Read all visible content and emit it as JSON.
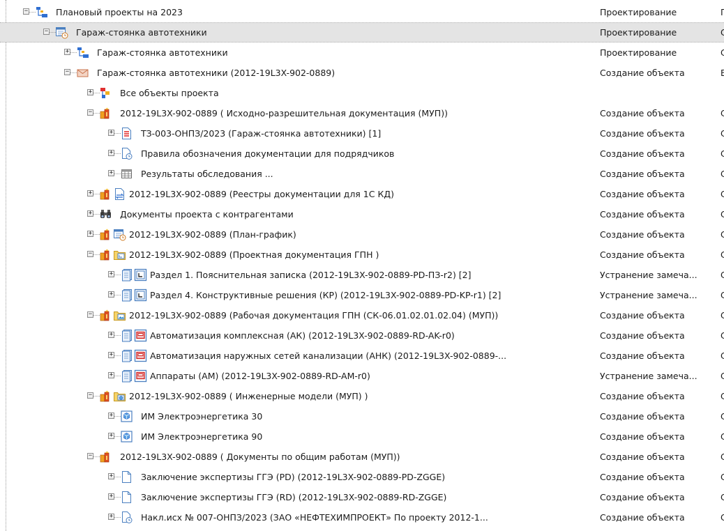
{
  "tree": {
    "rows": [
      {
        "depth": 0,
        "toggle": "minus",
        "icons": [
          "project-plan-icon"
        ],
        "label": "Плановый проекты на 2023",
        "status": "Проектирование",
        "extra": "П"
      },
      {
        "depth": 1,
        "toggle": "minus",
        "icons": [
          "calendar-clock-icon"
        ],
        "label": "Гараж-стоянка автотехники",
        "status": "Проектирование",
        "extra": "С",
        "selected": true
      },
      {
        "depth": 2,
        "toggle": "plus",
        "icons": [
          "project-plan-icon"
        ],
        "label": "Гараж-стоянка автотехники",
        "status": "Проектирование",
        "extra": "С"
      },
      {
        "depth": 2,
        "toggle": "minus",
        "icons": [
          "envelope-icon"
        ],
        "label": "Гараж-стоянка автотехники (2012-19L3X-902-0889)",
        "status": "Создание объекта",
        "extra": "В"
      },
      {
        "depth": 3,
        "toggle": "plus",
        "icons": [
          "object-structure-icon"
        ],
        "label": "Все объекты проекта",
        "status": "",
        "extra": ""
      },
      {
        "depth": 3,
        "toggle": "minus",
        "icons": [
          "package-icon"
        ],
        "label": "2012-19L3X-902-0889 (  Исходно-разрешительная документация (МУП))",
        "status": "Создание объекта",
        "extra": "С"
      },
      {
        "depth": 4,
        "toggle": "plus",
        "icons": [
          "red-document-icon"
        ],
        "label": "ТЗ-003-ОНПЗ/2023 (Гараж-стоянка автотехники) [1]",
        "status": "Создание объекта",
        "extra": "С"
      },
      {
        "depth": 4,
        "toggle": "plus",
        "icons": [
          "document-clock-icon"
        ],
        "label": "Правила обозначения документации для подрядчиков",
        "status": "Создание объекта",
        "extra": "С"
      },
      {
        "depth": 4,
        "toggle": "plus",
        "icons": [
          "table-icon"
        ],
        "label": "Результаты обследования ...",
        "status": "Создание объекта",
        "extra": "С"
      },
      {
        "depth": 3,
        "toggle": "plus",
        "icons": [
          "package-icon",
          "registry-sync-icon"
        ],
        "label": "2012-19L3X-902-0889 (Реестры документации для 1С КД)",
        "status": "Создание объекта",
        "extra": "С"
      },
      {
        "depth": 3,
        "toggle": "plus",
        "icons": [
          "binoculars-icon"
        ],
        "label": "Документы проекта с контрагентами",
        "status": "Создание объекта",
        "extra": "С"
      },
      {
        "depth": 3,
        "toggle": "plus",
        "icons": [
          "package-icon",
          "calendar-clock-icon"
        ],
        "label": "2012-19L3X-902-0889 (План-график)",
        "status": "Создание объекта",
        "extra": "С"
      },
      {
        "depth": 3,
        "toggle": "minus",
        "icons": [
          "package-icon",
          "folder-drawing-icon"
        ],
        "label": "2012-19L3X-902-0889 (Проектная документация ГПН  )",
        "status": "Создание объекта",
        "extra": "С"
      },
      {
        "depth": 4,
        "toggle": "plus",
        "icons": [
          "document-stack-icon",
          "drawing-sheet-icon"
        ],
        "label": "Раздел 1. Пояснительная записка (2012-19L3X-902-0889-PD-ПЗ-r2) [2]",
        "status": "Устранение замеча...",
        "extra": "С"
      },
      {
        "depth": 4,
        "toggle": "plus",
        "icons": [
          "document-stack-icon",
          "drawing-sheet-icon"
        ],
        "label": "Раздел 4. Конструктивные решения (КР) (2012-19L3X-902-0889-PD-KP-r1) [2]",
        "status": "Устранение замеча...",
        "extra": "С"
      },
      {
        "depth": 3,
        "toggle": "minus",
        "icons": [
          "package-icon",
          "folder-image-icon"
        ],
        "label": "2012-19L3X-902-0889 (Рабочая документация ГПН (СК-06.01.02.01.02.04) (МУП))",
        "status": "Создание объекта",
        "extra": "С"
      },
      {
        "depth": 4,
        "toggle": "plus",
        "icons": [
          "document-stack-icon",
          "red-frame-icon"
        ],
        "label": "Автоматизация комплексная (АК) (2012-19L3X-902-0889-RD-AK-r0)",
        "status": "Создание объекта",
        "extra": "С"
      },
      {
        "depth": 4,
        "toggle": "plus",
        "icons": [
          "document-stack-icon",
          "red-frame-icon"
        ],
        "label": "Автоматизация наружных сетей канализации (АНК) (2012-19L3X-902-0889-...",
        "status": "Создание объекта",
        "extra": "С"
      },
      {
        "depth": 4,
        "toggle": "plus",
        "icons": [
          "document-stack-icon",
          "red-frame-icon"
        ],
        "label": "Аппараты (АМ) (2012-19L3X-902-0889-RD-AM-r0)",
        "status": "Устранение замеча...",
        "extra": "С"
      },
      {
        "depth": 3,
        "toggle": "minus",
        "icons": [
          "package-icon",
          "folder-model-icon"
        ],
        "label": "2012-19L3X-902-0889 (  Инженерные модели  (МУП) )",
        "status": "Создание объекта",
        "extra": "С"
      },
      {
        "depth": 4,
        "toggle": "plus",
        "icons": [
          "model-3d-icon"
        ],
        "label": "ИМ Электроэнергетика 30",
        "status": "Создание объекта",
        "extra": "С"
      },
      {
        "depth": 4,
        "toggle": "plus",
        "icons": [
          "model-3d-icon"
        ],
        "label": "ИМ Электроэнергетика 90",
        "status": "Создание объекта",
        "extra": "С"
      },
      {
        "depth": 3,
        "toggle": "minus",
        "icons": [
          "package-icon"
        ],
        "label": "2012-19L3X-902-0889 (  Документы по общим работам (МУП))",
        "status": "Создание объекта",
        "extra": "С"
      },
      {
        "depth": 4,
        "toggle": "plus",
        "icons": [
          "blank-document-icon"
        ],
        "label": "Заключение экспертизы ГГЭ (PD) (2012-19L3X-902-0889-PD-ZGGE)",
        "status": "Создание объекта",
        "extra": "С"
      },
      {
        "depth": 4,
        "toggle": "plus",
        "icons": [
          "blank-document-icon"
        ],
        "label": "Заключение экспертизы ГГЭ (RD) (2012-19L3X-902-0889-RD-ZGGE)",
        "status": "Создание объекта",
        "extra": "С"
      },
      {
        "depth": 4,
        "toggle": "plus",
        "icons": [
          "document-clock-icon"
        ],
        "label": "Накл.исх № 007-ОНПЗ/2023 (ЗАО «НЕФТЕХИМПРОЕКТ» По проекту 2012-1...",
        "status": "Создание объекта",
        "extra": "С"
      }
    ]
  }
}
